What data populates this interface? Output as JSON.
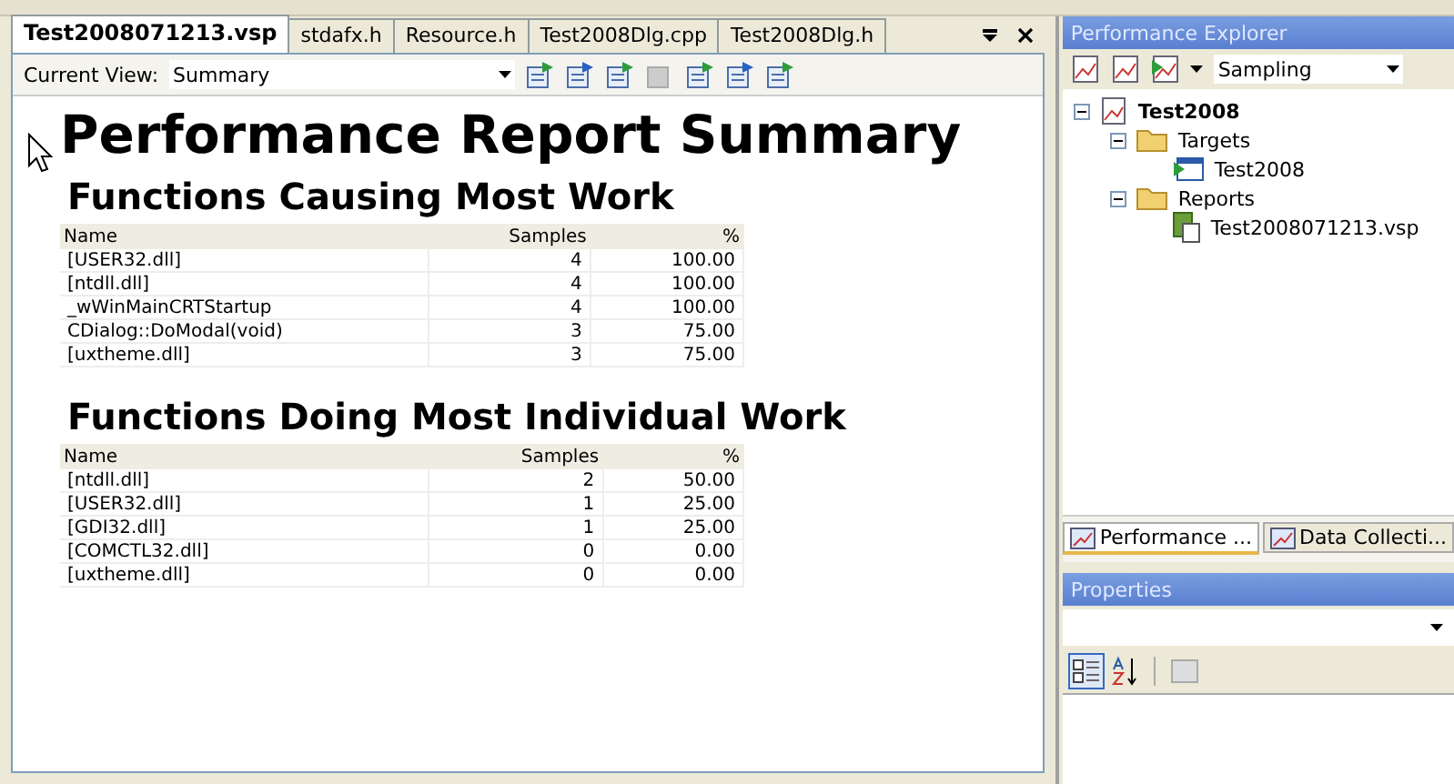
{
  "document_tabs": [
    {
      "label": "Test2008071213.vsp",
      "selected": true
    },
    {
      "label": "stdafx.h",
      "selected": false
    },
    {
      "label": "Resource.h",
      "selected": false
    },
    {
      "label": "Test2008Dlg.cpp",
      "selected": false
    },
    {
      "label": "Test2008Dlg.h",
      "selected": false
    }
  ],
  "view_toolbar": {
    "label": "Current View:",
    "value": "Summary"
  },
  "report": {
    "title": "Performance Report Summary",
    "sections": [
      {
        "heading": "Functions Causing Most Work",
        "columns": [
          "Name",
          "Samples",
          "%"
        ],
        "rows": [
          [
            "[USER32.dll]",
            "4",
            "100.00"
          ],
          [
            "[ntdll.dll]",
            "4",
            "100.00"
          ],
          [
            "_wWinMainCRTStartup",
            "4",
            "100.00"
          ],
          [
            "CDialog::DoModal(void)",
            "3",
            "75.00"
          ],
          [
            "[uxtheme.dll]",
            "3",
            "75.00"
          ]
        ]
      },
      {
        "heading": "Functions Doing Most Individual Work",
        "columns": [
          "Name",
          "Samples",
          "%"
        ],
        "rows": [
          [
            "[ntdll.dll]",
            "2",
            "50.00"
          ],
          [
            "[USER32.dll]",
            "1",
            "25.00"
          ],
          [
            "[GDI32.dll]",
            "1",
            "25.00"
          ],
          [
            "[COMCTL32.dll]",
            "0",
            "0.00"
          ],
          [
            "[uxtheme.dll]",
            "0",
            "0.00"
          ]
        ]
      }
    ]
  },
  "performance_explorer": {
    "title": "Performance Explorer",
    "method": "Sampling",
    "tree": [
      {
        "label": "Test2008",
        "kind": "session",
        "expanded": true,
        "children": [
          {
            "label": "Targets",
            "kind": "folder",
            "expanded": true,
            "children": [
              {
                "label": "Test2008",
                "kind": "target"
              }
            ]
          },
          {
            "label": "Reports",
            "kind": "folder",
            "expanded": true,
            "children": [
              {
                "label": "Test2008071213.vsp",
                "kind": "report"
              }
            ]
          }
        ]
      }
    ]
  },
  "panel_tabs": [
    {
      "label": "Performance ...",
      "selected": true
    },
    {
      "label": "Data Collecti...",
      "selected": false
    }
  ],
  "properties": {
    "title": "Properties"
  }
}
